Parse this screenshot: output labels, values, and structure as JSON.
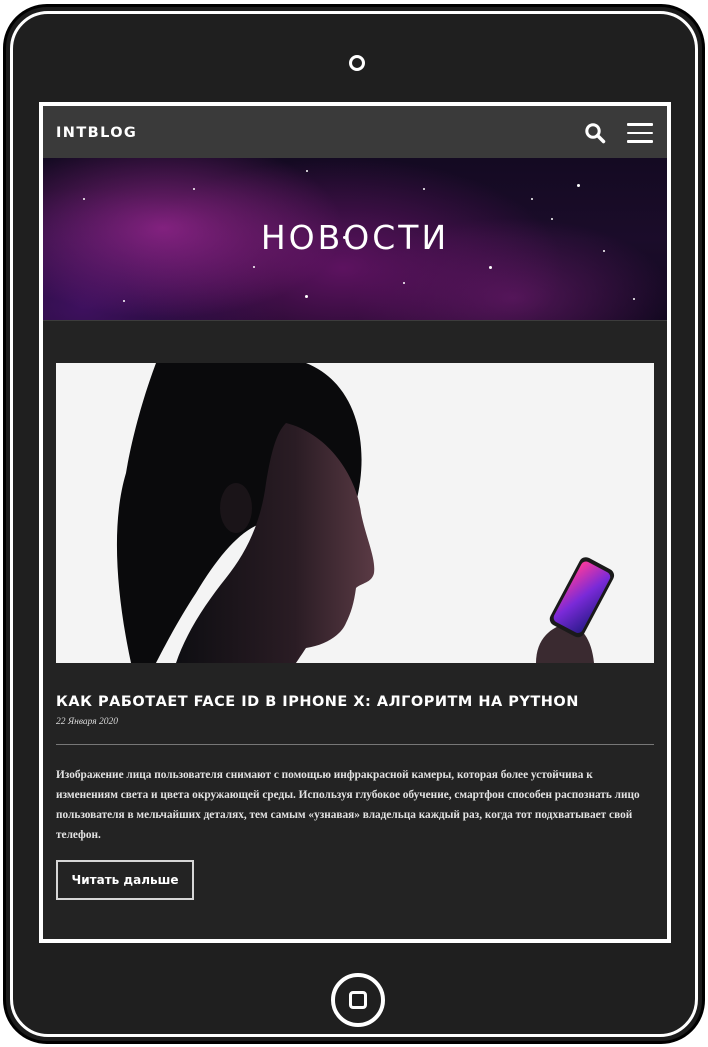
{
  "navbar": {
    "brand": "INTBLOG",
    "search_icon": "search-icon",
    "menu_icon": "hamburger-menu-icon"
  },
  "hero": {
    "title": "НОВОСТИ"
  },
  "post": {
    "image_alt": "woman-profile-with-iphone",
    "title": "КАК РАБОТАЕТ FACE ID В IPHONE X: АЛГОРИТМ НА PYTHON",
    "date": "22 Января 2020",
    "excerpt": "Изображение лица пользователя снимают с помощью инфракрасной камеры, которая более устойчива к изменениям света и цвета окружающей среды. Используя глубокое обучение, смартфон способен распознать лицо пользователя в мельчайших деталях, тем самым «узнавая» владельца каждый раз, когда тот подхватывает свой телефон.",
    "read_more": "Читать дальше"
  },
  "colors": {
    "frame": "#1c1c1c",
    "navbar": "#3a3a3a",
    "screen_bg": "#232323",
    "accent": "#ffffff"
  }
}
